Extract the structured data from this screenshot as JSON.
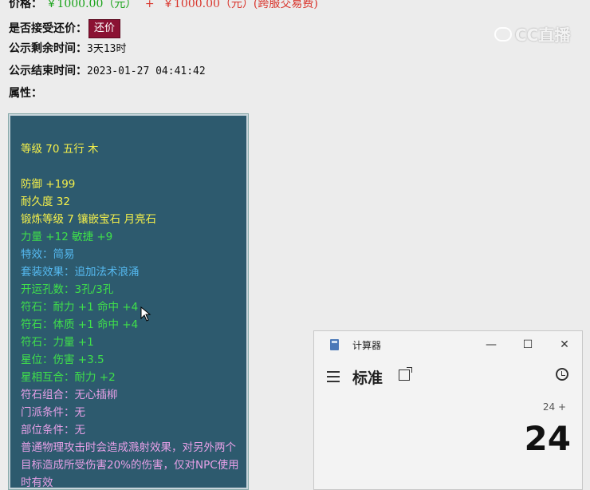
{
  "header": {
    "price_label": "价格：",
    "price_value": "￥1000.00（元）",
    "price_plus": "+",
    "price_fee": "￥1000.00（元）(跨服交易费)",
    "offer_label": "是否接受还价：",
    "offer_button": "还价",
    "remaining_label": "公示剩余时间：",
    "remaining_value": "3天13时",
    "end_label": "公示结束时间：",
    "end_value": "2023-01-27 04:41:42",
    "attr_label": "属性："
  },
  "item": {
    "level_line": "等级 70 五行 木",
    "defense": "防御 +199",
    "durability": "耐久度 32",
    "forge": "锻炼等级 7 镶嵌宝石 月亮石",
    "stats": "力量 +12 敏捷 +9",
    "special": "特效：简易",
    "set_effect": "套装效果：追加法术浪涌",
    "holes": "开运孔数：3孔/3孔",
    "rune1": "符石：耐力 +1 命中 +4",
    "rune2": "符石：体质 +1 命中 +4",
    "rune3": "符石：力量 +1",
    "star": "星位：伤害 +3.5",
    "star_combo": "星相互合：耐力 +2",
    "rune_combo": "符石组合：无心插柳",
    "school_req": "门派条件：无",
    "slot_req": "部位条件：无",
    "desc": "普通物理攻击时会造成溅射效果，对另外两个目标造成所受伤害20%的伤害，仅对NPC使用时有效"
  },
  "watermark": "CC直播",
  "calculator": {
    "title": "计算器",
    "mode": "标准",
    "expression": "24 +",
    "display": "24",
    "min_icon": "—",
    "max_icon": "☐",
    "close_icon": "✕"
  }
}
